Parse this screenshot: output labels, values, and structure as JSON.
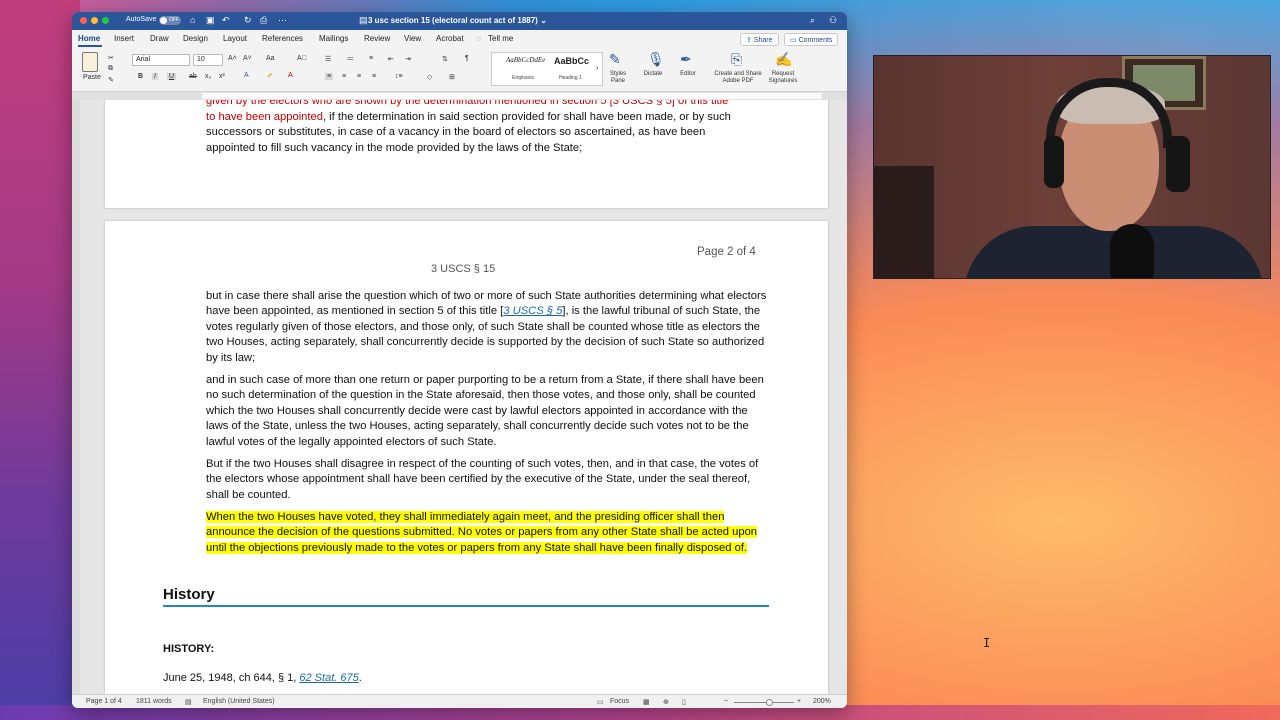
{
  "window": {
    "autosave_label": "AutoSave",
    "autosave_state": "OFF",
    "doc_title": "3 usc section 15 (electoral count act of 1887) ⌄"
  },
  "tabs": [
    "Home",
    "Insert",
    "Draw",
    "Design",
    "Layout",
    "References",
    "Mailings",
    "Review",
    "View",
    "Acrobat",
    "Tell me"
  ],
  "share_label": "Share",
  "comments_label": "Comments",
  "ribbon": {
    "paste_label": "Paste",
    "font_name": "Arial",
    "font_size": "10",
    "styles": [
      {
        "sample": "AaBbCcDdEe",
        "caption": "Emphasis"
      },
      {
        "sample": "AaBbCc",
        "caption": "Heading 1"
      }
    ],
    "styles_pane": "Styles Pane",
    "dictate": "Dictate",
    "editor": "Editor",
    "create_share": "Create and Share Adobe PDF",
    "request_sigs": "Request Signatures"
  },
  "page1": {
    "top_red_line": "given by the electors who are shown by the determination mentioned in section 5 [3 USCS § 5] of this title",
    "red_continued": "to have been appointed",
    "line1_rest": ", if the determination in said section provided for shall have been made, or by such",
    "line2": "successors or substitutes, in case of a vacancy in the board of electors so ascertained, as have been",
    "line3": "appointed to fill such vacancy in the mode provided by the laws of the State;"
  },
  "page2": {
    "page_number": "Page 2 of 4",
    "header": "3 USCS § 15",
    "para1_a": "but in case there shall arise the question which of two or more of such State authorities determining what electors have been appointed, as mentioned in section 5 of this title [",
    "para1_link": "3 USCS § 5",
    "para1_b": "], is the lawful tribunal of such State, the votes regularly given of those electors, and those only, of such State shall be counted whose title as electors the two Houses, acting separately, shall concurrently decide is supported by the decision of such State so authorized by its law;",
    "para2": "and in such case of more than one return or paper purporting to be a return from a State, if there shall have been no such determination of the question in the State aforesaid, then those votes, and those only, shall be counted which the two Houses shall concurrently decide were cast by lawful electors appointed in accordance with the laws of the State, unless the two Houses, acting separately, shall concurrently decide such votes not to be the lawful votes of the legally appointed electors of such State.",
    "para3": "But if the two Houses shall disagree in respect of the counting of such votes, then, and in that case, the votes of the electors whose appointment shall have been certified by the executive of the State, under the seal thereof, shall be counted.",
    "para4": "When the two Houses have voted, they shall immediately again meet, and the presiding officer shall then announce the decision of the questions submitted. No votes or papers from any other State shall be acted upon until the objections previously made to the votes or papers from any State shall have been finally disposed of.",
    "history_heading": "History",
    "history_label": "HISTORY:",
    "history_text": "June 25, 1948, ch 644, § 1, ",
    "history_link": "62 Stat. 675",
    "history_end": "."
  },
  "status": {
    "page": "Page 1 of 4",
    "words": "1811 words",
    "language": "English (United States)",
    "focus": "Focus",
    "zoom": "200%"
  },
  "colors": {
    "word_blue": "#2b579a",
    "highlight": "#ffff00",
    "red_text": "#c00000",
    "link": "#1a6aa6"
  }
}
